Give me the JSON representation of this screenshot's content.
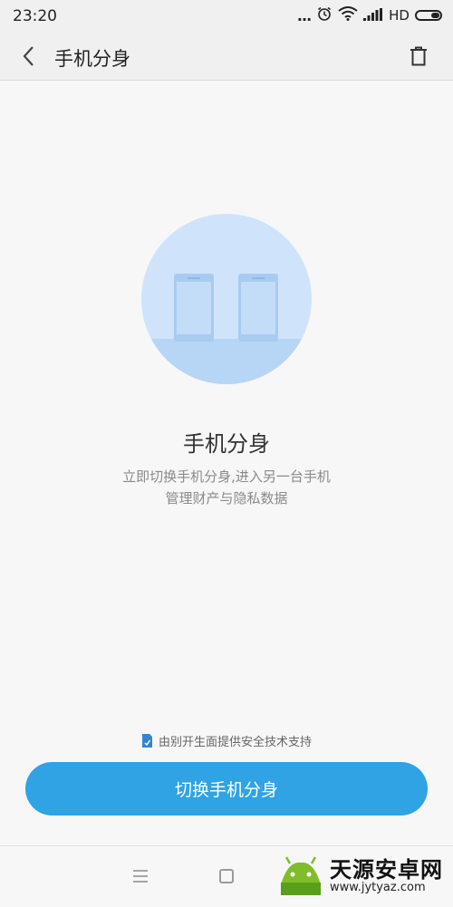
{
  "status_bar": {
    "time": "23:20",
    "dots": "...",
    "network": "HD",
    "icons": [
      "alarm-icon",
      "wifi-icon",
      "signal-icon",
      "battery-icon"
    ]
  },
  "header": {
    "title": "手机分身",
    "back_icon": "back-arrow-icon",
    "delete_icon": "trash-icon"
  },
  "main": {
    "illustration": "two-phones-illustration",
    "heading": "手机分身",
    "description_line1": "立即切换手机分身,进入另一台手机",
    "description_line2": "管理财产与隐私数据"
  },
  "footer": {
    "security_note": "由别开生面提供安全技术支持",
    "primary_button": "切换手机分身"
  },
  "nav": {
    "icons": [
      "menu-icon",
      "home-icon"
    ]
  },
  "watermark": {
    "title": "天源安卓网",
    "url": "www.jytyaz.com"
  },
  "colors": {
    "accent": "#2fa3e4",
    "circle": "#cfe4fb",
    "background": "#f7f7f7"
  }
}
